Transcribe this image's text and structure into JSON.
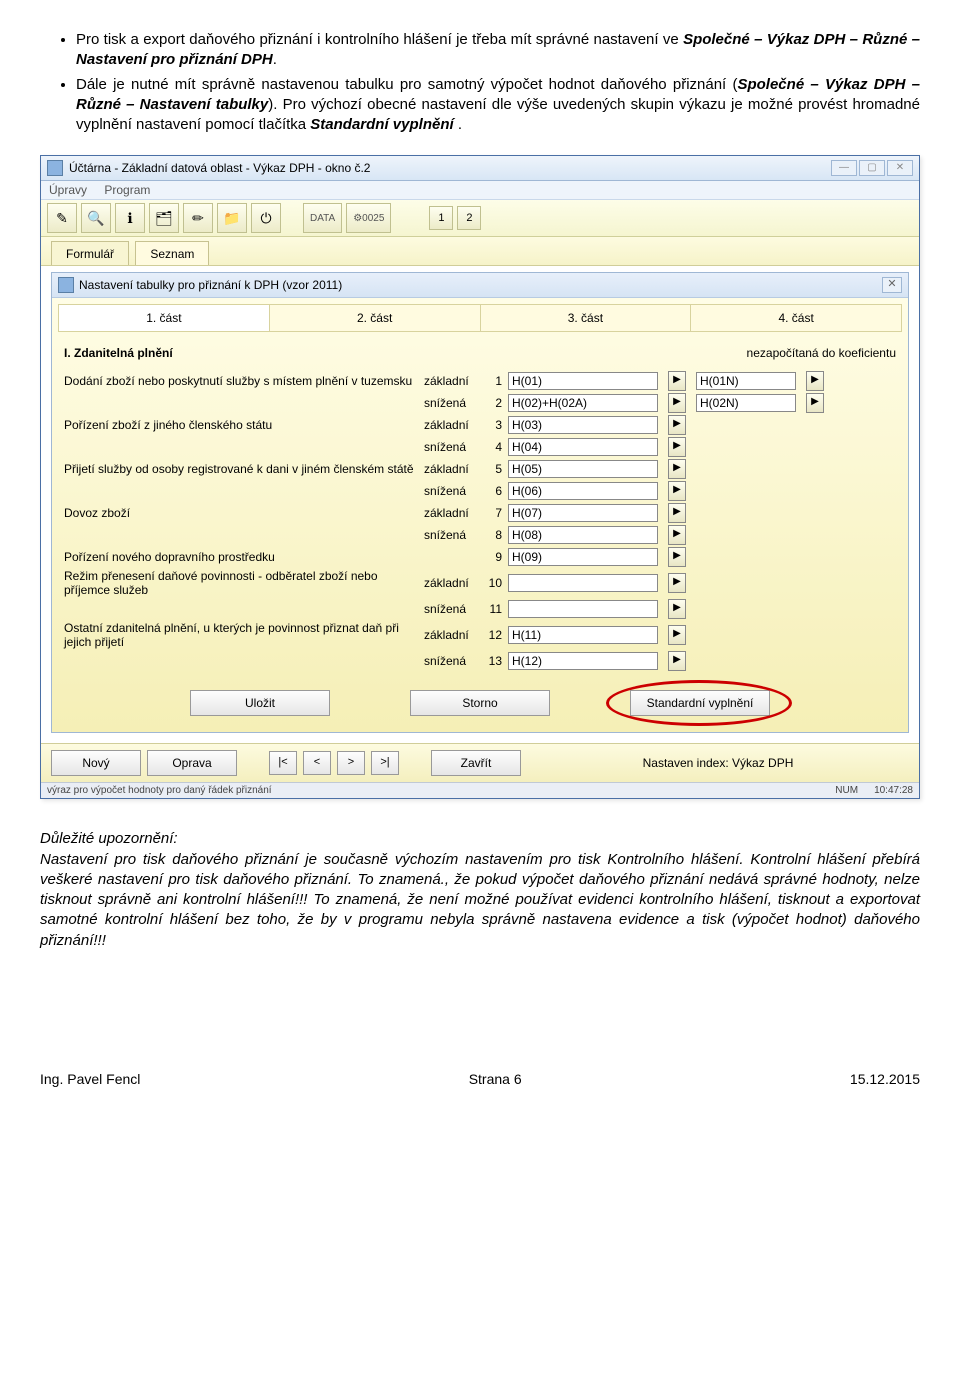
{
  "doc": {
    "bullets": [
      {
        "pre": "Pro tisk a export daňového přiznání i kontrolního hlášení je třeba mít správné nastavení ve ",
        "bold": "Společné – Výkaz DPH – Různé – Nastavení pro přiznání DPH",
        "post": "."
      },
      {
        "pre": "Dále je nutné mít správně nastavenou tabulku pro samotný výpočet hodnot daňového přiznání (",
        "bold": "Společné – Výkaz DPH – Různé – Nastavení tabulky",
        "mid": "). Pro výchozí obecné nastavení dle výše uvedených skupin výkazu je možné provést hromadné vyplnění nastavení pomocí tlačítka ",
        "bold2": "Standardní vyplnění",
        "post": " ."
      }
    ],
    "notice_heading": "Důležité upozornění:",
    "notice_body": "Nastavení pro tisk daňového přiznání je současně výchozím nastavením pro tisk Kontrolního hlášení. Kontrolní hlášení přebírá veškeré nastavení pro tisk daňového přiznání. To znamená., že pokud výpočet daňového přiznání nedává správné hodnoty, nelze tisknout správně ani kontrolní hlášení!!! To znamená, že není možné používat evidenci kontrolního hlášení, tisknout a exportovat samotné kontrolní hlášení bez toho, že by v programu nebyla správně nastavena evidence a tisk (výpočet hodnot) daňového přiznání!!!"
  },
  "app": {
    "title": "Účtárna - Základní datová oblast - Výkaz DPH - okno č.2",
    "menu": {
      "item1": "Úpravy",
      "item2": "Program"
    },
    "toolbar": {
      "icons": [
        "✎",
        "🔍",
        "ℹ",
        "🗂",
        "✏",
        "📁",
        "⏻"
      ],
      "data_label": "DATA",
      "gear_label": "0025",
      "num1": "1",
      "num2": "2"
    },
    "tabs": {
      "t1": "Formulář",
      "t2": "Seznam"
    },
    "dialog": {
      "title": "Nastavení tabulky pro přiznání k DPH (vzor 2011)",
      "parts": [
        "1. část",
        "2. část",
        "3. část",
        "4. část"
      ],
      "section_left": "I. Zdanitelná plnění",
      "section_right": "nezapočítaná do koeficientu",
      "rows": [
        {
          "desc": "Dodání zboží nebo poskytnutí služby s místem plnění v tuzemsku",
          "rate": "základní",
          "num": "1",
          "val": "H(01)",
          "val2": "H(01N)",
          "show2": true
        },
        {
          "desc": "",
          "rate": "snížená",
          "num": "2",
          "val": "H(02)+H(02A)",
          "val2": "H(02N)",
          "show2": true
        },
        {
          "desc": "Pořízení zboží z jiného členského státu",
          "rate": "základní",
          "num": "3",
          "val": "H(03)",
          "val2": "",
          "show2": false
        },
        {
          "desc": "",
          "rate": "snížená",
          "num": "4",
          "val": "H(04)",
          "val2": "",
          "show2": false
        },
        {
          "desc": "Přijetí služby od osoby registrované k dani v jiném členském státě",
          "rate": "základní",
          "num": "5",
          "val": "H(05)",
          "val2": "",
          "show2": false
        },
        {
          "desc": "",
          "rate": "snížená",
          "num": "6",
          "val": "H(06)",
          "val2": "",
          "show2": false
        },
        {
          "desc": "Dovoz zboží",
          "rate": "základní",
          "num": "7",
          "val": "H(07)",
          "val2": "",
          "show2": false
        },
        {
          "desc": "",
          "rate": "snížená",
          "num": "8",
          "val": "H(08)",
          "val2": "",
          "show2": false
        },
        {
          "desc": "Pořízení nového dopravního prostředku",
          "rate": "",
          "num": "9",
          "val": "H(09)",
          "val2": "",
          "show2": false
        },
        {
          "desc": "Režim přenesení daňové povinnosti - odběratel zboží nebo příjemce služeb",
          "rate": "základní",
          "num": "10",
          "val": "",
          "val2": "",
          "show2": false
        },
        {
          "desc": "",
          "rate": "snížená",
          "num": "11",
          "val": "",
          "val2": "",
          "show2": false
        },
        {
          "desc": "Ostatní zdanitelná plnění, u kterých je povinnost přiznat daň při jejich přijetí",
          "rate": "základní",
          "num": "12",
          "val": "H(11)",
          "val2": "",
          "show2": false
        },
        {
          "desc": "",
          "rate": "snížená",
          "num": "13",
          "val": "H(12)",
          "val2": "",
          "show2": false
        }
      ],
      "buttons": {
        "save": "Uložit",
        "cancel": "Storno",
        "std": "Standardní vyplnění"
      }
    },
    "bottom": {
      "status_label": "Nastaven index: Výkaz DPH",
      "nový": "Nový",
      "oprava": "Oprava",
      "first": "|<",
      "prev": "<",
      "next": ">",
      "last": ">|",
      "close": "Zavřít"
    },
    "status": {
      "left": "výraz pro výpočet hodnoty pro daný řádek přiznání",
      "num": "NUM",
      "time": "10:47:28"
    }
  },
  "footer": {
    "left": "Ing. Pavel Fencl",
    "center": "Strana 6",
    "right": "15.12.2015"
  }
}
